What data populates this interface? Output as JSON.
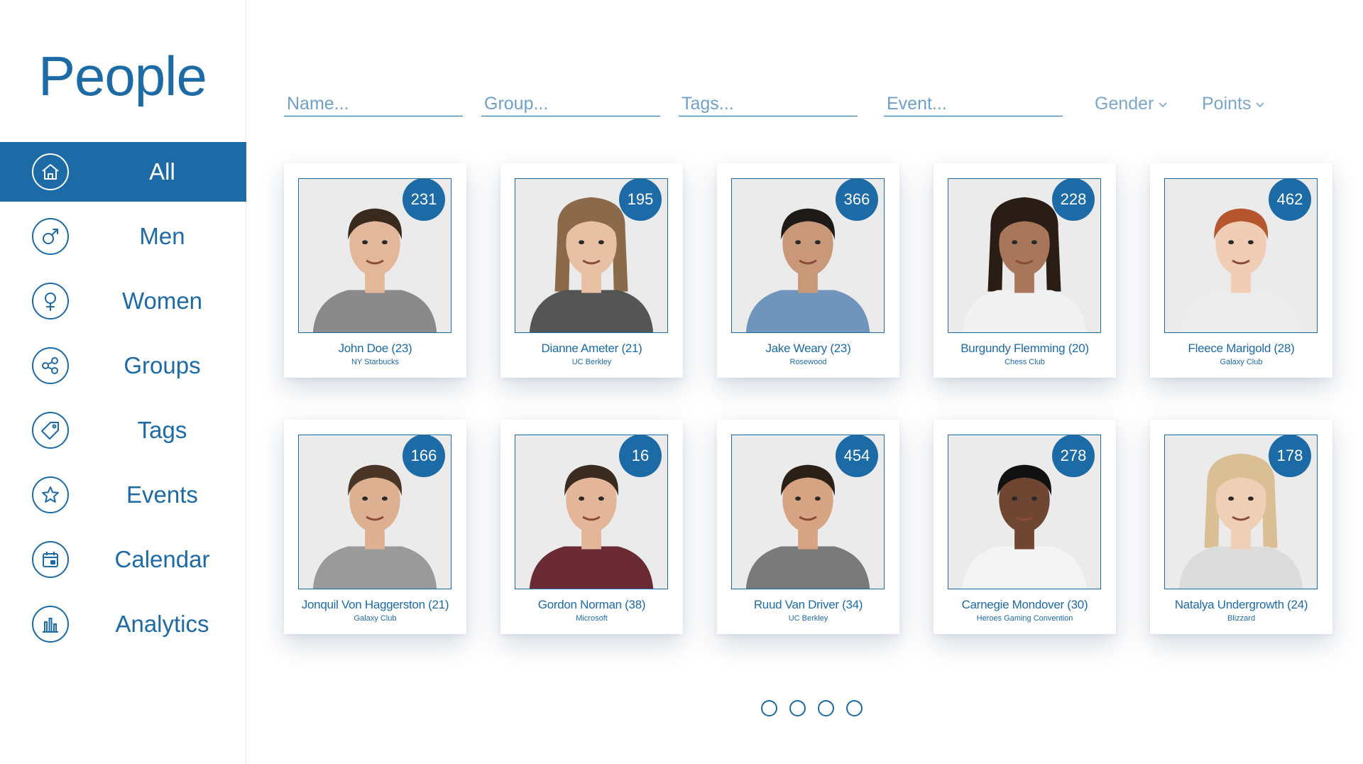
{
  "sidebar": {
    "title": "People",
    "items": [
      {
        "label": "All",
        "icon": "home-icon",
        "active": true
      },
      {
        "label": "Men",
        "icon": "male-icon",
        "active": false
      },
      {
        "label": "Women",
        "icon": "female-icon",
        "active": false
      },
      {
        "label": "Groups",
        "icon": "share-icon",
        "active": false
      },
      {
        "label": "Tags",
        "icon": "tag-icon",
        "active": false
      },
      {
        "label": "Events",
        "icon": "star-icon",
        "active": false
      },
      {
        "label": "Calendar",
        "icon": "calendar-icon",
        "active": false
      },
      {
        "label": "Analytics",
        "icon": "bar-chart-icon",
        "active": false
      }
    ]
  },
  "filters": {
    "name_placeholder": "Name...",
    "group_placeholder": "Group...",
    "tags_placeholder": "Tags...",
    "event_placeholder": "Event...",
    "gender_label": "Gender",
    "points_label": "Points"
  },
  "people": [
    {
      "name": "John Doe (23)",
      "group": "NY Starbucks",
      "points": "231"
    },
    {
      "name": "Dianne Ameter (21)",
      "group": "UC Berkley",
      "points": "195"
    },
    {
      "name": "Jake Weary (23)",
      "group": "Rosewood",
      "points": "366"
    },
    {
      "name": "Burgundy Flemming (20)",
      "group": "Chess Club",
      "points": "228"
    },
    {
      "name": "Fleece Marigold (28)",
      "group": "Galaxy Club",
      "points": "462"
    },
    {
      "name": "Jonquil Von Haggerston (21)",
      "group": "Galaxy Club",
      "points": "166"
    },
    {
      "name": "Gordon Norman (38)",
      "group": "Microsoft",
      "points": "16"
    },
    {
      "name": "Ruud Van Driver (34)",
      "group": "UC Berkley",
      "points": "454"
    },
    {
      "name": "Carnegie Mondover (30)",
      "group": "Heroes Gaming Convention",
      "points": "278"
    },
    {
      "name": "Natalya Undergrowth (24)",
      "group": "Blizzard",
      "points": "178"
    }
  ],
  "pagination": {
    "pages": 4
  },
  "colors": {
    "accent": "#1c6aa6",
    "background": "#ffffff"
  }
}
